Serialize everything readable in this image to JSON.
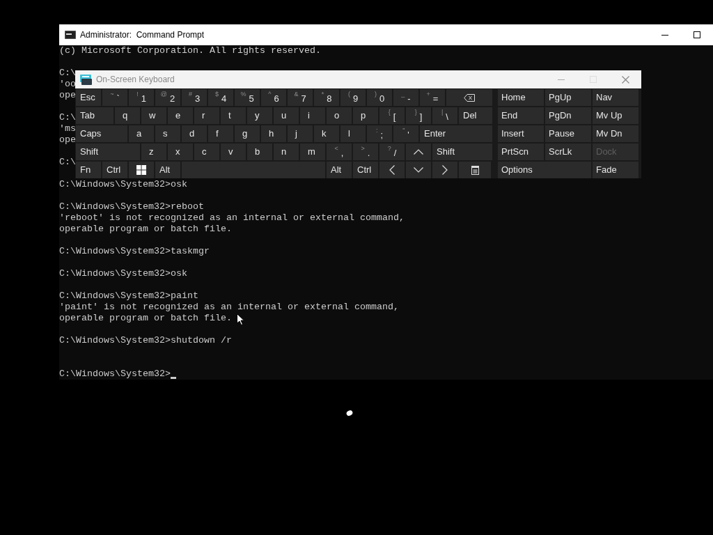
{
  "console": {
    "title": "Administrator:  Command Prompt",
    "lines": [
      {
        "kind": "text",
        "text": "(c) Microsoft Corporation. All rights reserved."
      },
      {
        "kind": "blank"
      },
      {
        "kind": "text",
        "text": "C:\\"
      },
      {
        "kind": "text",
        "text": "'oo"
      },
      {
        "kind": "text",
        "text": "ope"
      },
      {
        "kind": "blank"
      },
      {
        "kind": "text",
        "text": "C:\\"
      },
      {
        "kind": "text",
        "text": "'ms"
      },
      {
        "kind": "text",
        "text": "ope"
      },
      {
        "kind": "blank"
      },
      {
        "kind": "text",
        "text": "C:\\"
      },
      {
        "kind": "blank"
      },
      {
        "kind": "text",
        "text": "C:\\Windows\\System32>osk"
      },
      {
        "kind": "blank"
      },
      {
        "kind": "text",
        "text": "C:\\Windows\\System32>reboot"
      },
      {
        "kind": "text",
        "text": "'reboot' is not recognized as an internal or external command,"
      },
      {
        "kind": "text",
        "text": "operable program or batch file."
      },
      {
        "kind": "blank"
      },
      {
        "kind": "text",
        "text": "C:\\Windows\\System32>taskmgr"
      },
      {
        "kind": "blank"
      },
      {
        "kind": "text",
        "text": "C:\\Windows\\System32>osk"
      },
      {
        "kind": "blank"
      },
      {
        "kind": "text",
        "text": "C:\\Windows\\System32>paint"
      },
      {
        "kind": "text",
        "text": "'paint' is not recognized as an internal or external command,"
      },
      {
        "kind": "text",
        "text": "operable program or batch file."
      },
      {
        "kind": "blank"
      },
      {
        "kind": "text",
        "text": "C:\\Windows\\System32>shutdown /r"
      },
      {
        "kind": "blank"
      },
      {
        "kind": "blank"
      }
    ],
    "prompt": {
      "text": "C:\\Windows\\System32>",
      "cursor": true
    }
  },
  "keyboard": {
    "title": "On-Screen Keyboard",
    "main_rows": [
      [
        {
          "kind": "key",
          "label": "Esc"
        },
        {
          "kind": "key",
          "label": "`",
          "shift": "~"
        },
        {
          "kind": "key",
          "label": "1",
          "shift": "!"
        },
        {
          "kind": "key",
          "label": "2",
          "shift": "@"
        },
        {
          "kind": "key",
          "label": "3",
          "shift": "#"
        },
        {
          "kind": "key",
          "label": "4",
          "shift": "$"
        },
        {
          "kind": "key",
          "label": "5",
          "shift": "%"
        },
        {
          "kind": "key",
          "label": "6",
          "shift": "^"
        },
        {
          "kind": "key",
          "label": "7",
          "shift": "&"
        },
        {
          "kind": "key",
          "label": "8",
          "shift": "*"
        },
        {
          "kind": "key",
          "label": "9",
          "shift": "("
        },
        {
          "kind": "key",
          "label": "0",
          "shift": ")"
        },
        {
          "kind": "key",
          "label": "-",
          "shift": "_"
        },
        {
          "kind": "key",
          "label": "=",
          "shift": "+"
        },
        {
          "kind": "backspace"
        }
      ],
      [
        {
          "kind": "key",
          "label": "Tab"
        },
        {
          "kind": "key",
          "label": "q"
        },
        {
          "kind": "key",
          "label": "w"
        },
        {
          "kind": "key",
          "label": "e"
        },
        {
          "kind": "key",
          "label": "r"
        },
        {
          "kind": "key",
          "label": "t"
        },
        {
          "kind": "key",
          "label": "y"
        },
        {
          "kind": "key",
          "label": "u"
        },
        {
          "kind": "key",
          "label": "i"
        },
        {
          "kind": "key",
          "label": "o"
        },
        {
          "kind": "key",
          "label": "p"
        },
        {
          "kind": "key",
          "label": "[",
          "shift": "{"
        },
        {
          "kind": "key",
          "label": "]",
          "shift": "}"
        },
        {
          "kind": "key",
          "label": "\\",
          "shift": "|"
        },
        {
          "kind": "key",
          "label": "Del"
        }
      ],
      [
        {
          "kind": "key",
          "label": "Caps"
        },
        {
          "kind": "key",
          "label": "a"
        },
        {
          "kind": "key",
          "label": "s"
        },
        {
          "kind": "key",
          "label": "d"
        },
        {
          "kind": "key",
          "label": "f"
        },
        {
          "kind": "key",
          "label": "g"
        },
        {
          "kind": "key",
          "label": "h"
        },
        {
          "kind": "key",
          "label": "j"
        },
        {
          "kind": "key",
          "label": "k"
        },
        {
          "kind": "key",
          "label": "l"
        },
        {
          "kind": "key",
          "label": ";",
          "shift": ":"
        },
        {
          "kind": "key",
          "label": "'",
          "shift": "\""
        },
        {
          "kind": "key",
          "label": "Enter"
        }
      ],
      [
        {
          "kind": "key",
          "label": "Shift"
        },
        {
          "kind": "key",
          "label": "z"
        },
        {
          "kind": "key",
          "label": "x"
        },
        {
          "kind": "key",
          "label": "c"
        },
        {
          "kind": "key",
          "label": "v"
        },
        {
          "kind": "key",
          "label": "b"
        },
        {
          "kind": "key",
          "label": "n"
        },
        {
          "kind": "key",
          "label": "m"
        },
        {
          "kind": "key",
          "label": ",",
          "shift": "<"
        },
        {
          "kind": "key",
          "label": ".",
          "shift": ">"
        },
        {
          "kind": "key",
          "label": "/",
          "shift": "?"
        },
        {
          "kind": "up"
        },
        {
          "kind": "key",
          "label": "Shift"
        }
      ],
      [
        {
          "kind": "key",
          "label": "Fn"
        },
        {
          "kind": "key",
          "label": "Ctrl"
        },
        {
          "kind": "windows"
        },
        {
          "kind": "key",
          "label": "Alt"
        },
        {
          "kind": "space"
        },
        {
          "kind": "key",
          "label": "Alt"
        },
        {
          "kind": "key",
          "label": "Ctrl"
        },
        {
          "kind": "left"
        },
        {
          "kind": "down"
        },
        {
          "kind": "right"
        },
        {
          "kind": "menu"
        }
      ]
    ],
    "side_rows": [
      [
        {
          "label": "Home",
          "disabled": false
        },
        {
          "label": "PgUp",
          "disabled": false
        },
        {
          "label": "Nav",
          "disabled": false
        }
      ],
      [
        {
          "label": "End",
          "disabled": false
        },
        {
          "label": "PgDn",
          "disabled": false
        },
        {
          "label": "Mv Up",
          "disabled": false
        }
      ],
      [
        {
          "label": "Insert",
          "disabled": false
        },
        {
          "label": "Pause",
          "disabled": false
        },
        {
          "label": "Mv Dn",
          "disabled": false
        }
      ],
      [
        {
          "label": "PrtScn",
          "disabled": false
        },
        {
          "label": "ScrLk",
          "disabled": false
        },
        {
          "label": "Dock",
          "disabled": true
        }
      ],
      [
        {
          "label": "Options",
          "disabled": false
        },
        {
          "label": "Fade",
          "disabled": false
        }
      ]
    ]
  }
}
